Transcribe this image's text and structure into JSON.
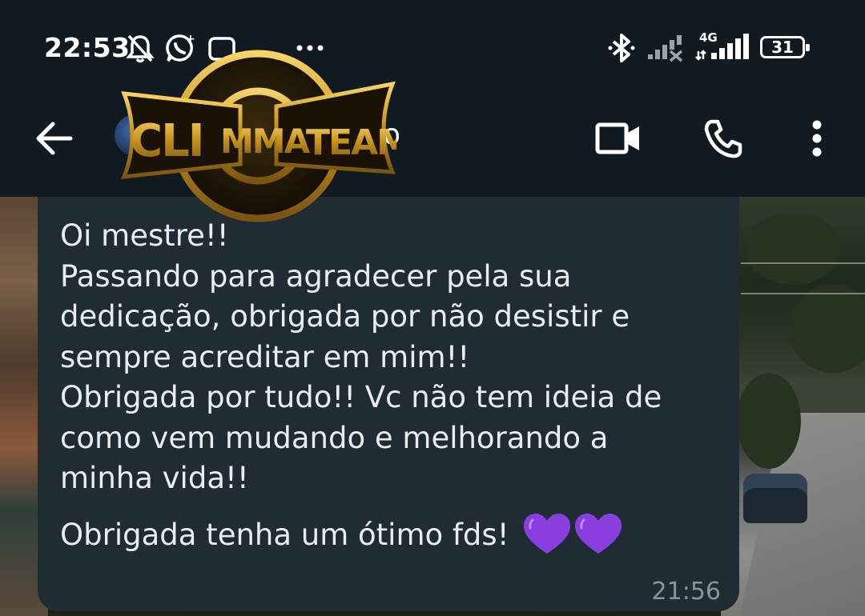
{
  "status_bar": {
    "time": "22:53",
    "network": "4G",
    "battery": "31",
    "icons": [
      "mute-icon",
      "whatsapp-icon",
      "notification-icon",
      "more-notifications-icon",
      "bluetooth-icon",
      "signal-off-icon",
      "signal-icon"
    ]
  },
  "app_bar": {
    "back_icon": "arrow-back-icon",
    "contact_name_visible": "o",
    "video_call_icon": "video-call-icon",
    "voice_call_icon": "phone-icon",
    "menu_icon": "more-vert-icon"
  },
  "overlay": {
    "logo_text": "CLIMMA TEAM"
  },
  "message": {
    "text": "Oi mestre!!\nPassando para agradecer pela sua\ndedicação, obrigada por não desistir e\nsempre acreditar em mim!!\nObrigada por tudo!! Vc não tem ideia de\ncomo vem mudando e melhorando a\nminha vida!!",
    "last_line": "Obrigada tenha um ótimo fds!",
    "emoji": "💜💜",
    "time": "21:56"
  },
  "colors": {
    "header_bg": "#101a20",
    "bubble_bg": "#1f2c33",
    "text": "#e9edef",
    "meta_text": "#8696a0",
    "heart": "#8a3ee0"
  }
}
